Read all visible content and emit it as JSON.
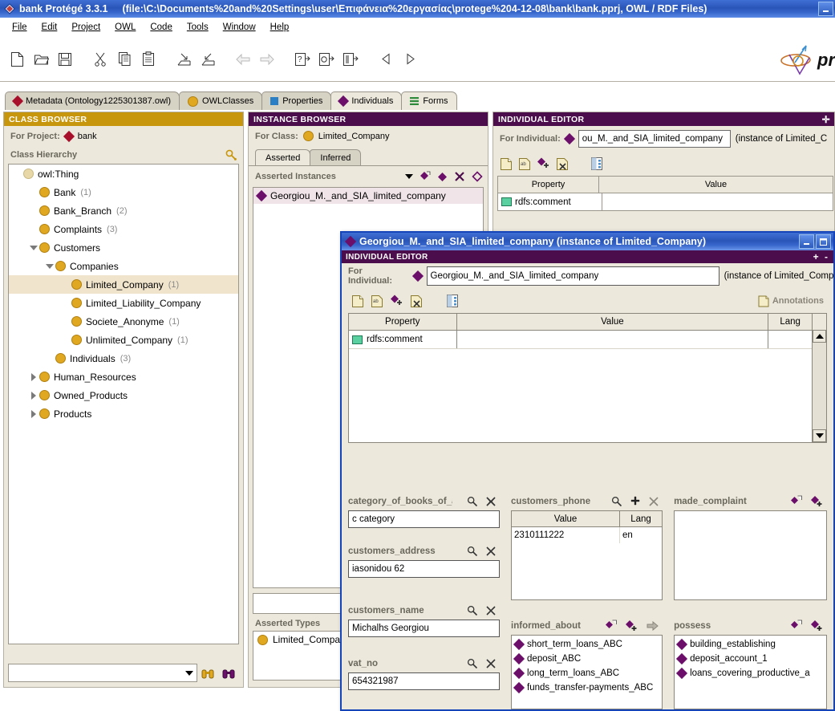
{
  "window": {
    "title": "bank  Protégé 3.3.1",
    "path": "(file:\\C:\\Documents%20and%20Settings\\user\\Επιφάνεια%20εργασίας\\protege%204-12-08\\bank\\bank.pprj,  OWL / RDF Files)",
    "icon": "protege-app-icon",
    "minimize_label": "_"
  },
  "menu": {
    "items": [
      {
        "label": "File",
        "name": "menu-file"
      },
      {
        "label": "Edit",
        "name": "menu-edit"
      },
      {
        "label": "Project",
        "name": "menu-project"
      },
      {
        "label": "OWL",
        "name": "menu-owl"
      },
      {
        "label": "Code",
        "name": "menu-code"
      },
      {
        "label": "Tools",
        "name": "menu-tools"
      },
      {
        "label": "Window",
        "name": "menu-window"
      },
      {
        "label": "Help",
        "name": "menu-help"
      }
    ]
  },
  "toolbar": {
    "icons": [
      "new-project-icon",
      "open-project-icon",
      "save-project-icon",
      "cut-icon",
      "copy-icon",
      "paste-icon",
      "import-icon",
      "export-icon",
      "undo-icon",
      "redo-icon",
      "query-icon",
      "create-icon",
      "instance-icon",
      "back-icon",
      "forward-icon"
    ],
    "logo_text": "pr"
  },
  "tabs": [
    {
      "label": "Metadata (Ontology1225301387.owl)",
      "icon": "red-diamond-icon",
      "active": false,
      "name": "tab-metadata"
    },
    {
      "label": "OWLClasses",
      "icon": "gold-circle-icon",
      "active": false,
      "name": "tab-owlclasses"
    },
    {
      "label": "Properties",
      "icon": "blue-square-icon",
      "active": false,
      "name": "tab-properties"
    },
    {
      "label": "Individuals",
      "icon": "purple-diamond-icon",
      "active": true,
      "name": "tab-individuals"
    },
    {
      "label": "Forms",
      "icon": "green-lines-icon",
      "active": false,
      "name": "tab-forms"
    }
  ],
  "class_browser": {
    "header": "CLASS BROWSER",
    "for_project_label": "For Project:",
    "project_name": "bank",
    "hierarchy_label": "Class Hierarchy",
    "search_icon": "class-search-icon",
    "tree": [
      {
        "label": "owl:Thing",
        "count": "",
        "indent": 0,
        "toggle": "none",
        "selected": false,
        "icon": "pale-circle-icon"
      },
      {
        "label": "Bank",
        "count": "(1)",
        "indent": 1,
        "toggle": "none",
        "selected": false,
        "icon": "gold-circle-icon"
      },
      {
        "label": "Bank_Branch",
        "count": "(2)",
        "indent": 1,
        "toggle": "none",
        "selected": false,
        "icon": "gold-circle-icon"
      },
      {
        "label": "Complaints",
        "count": "(3)",
        "indent": 1,
        "toggle": "none",
        "selected": false,
        "icon": "gold-circle-icon"
      },
      {
        "label": "Customers",
        "count": "",
        "indent": 1,
        "toggle": "down",
        "selected": false,
        "icon": "gold-circle-icon"
      },
      {
        "label": "Companies",
        "count": "",
        "indent": 2,
        "toggle": "down",
        "selected": false,
        "icon": "gold-circle-icon"
      },
      {
        "label": "Limited_Company",
        "count": "(1)",
        "indent": 3,
        "toggle": "none",
        "selected": true,
        "icon": "gold-circle-icon"
      },
      {
        "label": "Limited_Liability_Company",
        "count": "",
        "indent": 3,
        "toggle": "none",
        "selected": false,
        "icon": "gold-circle-icon"
      },
      {
        "label": "Societe_Anonyme",
        "count": "(1)",
        "indent": 3,
        "toggle": "none",
        "selected": false,
        "icon": "gold-circle-icon"
      },
      {
        "label": "Unlimited_Company",
        "count": "(1)",
        "indent": 3,
        "toggle": "none",
        "selected": false,
        "icon": "gold-circle-icon"
      },
      {
        "label": "Individuals",
        "count": "(3)",
        "indent": 2,
        "toggle": "none",
        "selected": false,
        "icon": "gold-circle-icon"
      },
      {
        "label": "Human_Resources",
        "count": "",
        "indent": 1,
        "toggle": "right",
        "selected": false,
        "icon": "gold-circle-icon"
      },
      {
        "label": "Owned_Products",
        "count": "",
        "indent": 1,
        "toggle": "right",
        "selected": false,
        "icon": "gold-circle-icon"
      },
      {
        "label": "Products",
        "count": "",
        "indent": 1,
        "toggle": "right",
        "selected": false,
        "icon": "gold-circle-icon"
      }
    ],
    "find_placeholder": "",
    "find_value": "",
    "find_icons": [
      "find-gold-binoculars-icon",
      "find-purple-binoculars-icon"
    ]
  },
  "instance_browser": {
    "header": "INSTANCE BROWSER",
    "for_class_label": "For Class:",
    "class_name": "Limited_Company",
    "subtabs": [
      {
        "label": "Asserted",
        "active": true,
        "name": "subtab-asserted"
      },
      {
        "label": "Inferred",
        "active": false,
        "name": "subtab-inferred"
      }
    ],
    "list_title": "Asserted Instances",
    "list_icons": [
      "sort-dropdown-icon",
      "create-instance-icon",
      "add-instance-icon",
      "delete-instance-icon",
      "clear-instance-icon"
    ],
    "instances": [
      {
        "label": "Georgiou_M._and_SIA_limited_company",
        "selected": true
      }
    ],
    "asserted_types_label": "Asserted Types",
    "asserted_types": [
      {
        "label": "Limited_Company"
      }
    ]
  },
  "individual_editor_bg": {
    "header": "INDIVIDUAL EDITOR",
    "for_individual_label": "For Individual:",
    "individual_name": "ou_M._and_SIA_limited_company",
    "instance_of": "(instance of Limited_C",
    "icons": [
      "new-note-icon",
      "edit-note-icon",
      "add-diamond-icon",
      "remove-note-icon",
      "split-view-icon"
    ],
    "columns": [
      "Property",
      "Value"
    ],
    "rows": [
      {
        "property": "rdfs:comment",
        "value": "",
        "icon": "datatype-icon"
      }
    ]
  },
  "dialog": {
    "title": "Georgiou_M._and_SIA_limited_company   (instance of Limited_Company)",
    "title_icon": "purple-diamond-icon",
    "buttons": [
      "minimize-button",
      "maximize-button"
    ],
    "header": "INDIVIDUAL EDITOR",
    "header_icons": "+ -",
    "for_individual_label": "For Individual:",
    "individual_name": "Georgiou_M._and_SIA_limited_company",
    "instance_of": "(instance of Limited_Comp",
    "icons": [
      "new-note-icon",
      "edit-note-icon",
      "add-diamond-icon",
      "remove-note-icon",
      "split-view-icon"
    ],
    "annotations_label": "Annotations",
    "table": {
      "columns": [
        "Property",
        "Value",
        "Lang"
      ],
      "rows": [
        {
          "property": "rdfs:comment",
          "value": "",
          "lang": "",
          "icon": "datatype-icon"
        }
      ]
    },
    "slots": [
      {
        "name": "category_of_books_of_a",
        "label": "category_of_books_of_a",
        "type": "text",
        "value": "c category",
        "icons": [
          "magnifier-icon",
          "clear-x-icon"
        ]
      },
      {
        "name": "customers_address",
        "label": "customers_address",
        "type": "text",
        "value": "iasonidou 62",
        "icons": [
          "magnifier-icon",
          "clear-x-icon"
        ]
      },
      {
        "name": "customers_name",
        "label": "customers_name",
        "type": "text",
        "value": "Michalhs Georgiou",
        "icons": [
          "magnifier-icon",
          "clear-x-icon"
        ]
      },
      {
        "name": "vat_no",
        "label": "vat_no",
        "type": "text",
        "value": "654321987",
        "icons": [
          "magnifier-icon",
          "clear-x-icon"
        ]
      },
      {
        "name": "customers_phone",
        "label": "customers_phone",
        "type": "table",
        "columns": [
          "Value",
          "Lang"
        ],
        "rows": [
          {
            "value": "2310111222",
            "lang": "en"
          }
        ],
        "icons": [
          "magnifier-icon",
          "add-plus-icon",
          "clear-x-icon"
        ]
      },
      {
        "name": "informed_about",
        "label": "informed_about",
        "type": "list",
        "items": [
          "short_term_loans_ABC",
          "deposit_ABC",
          "long_term_loans_ABC",
          "funds_transfer-payments_ABC"
        ],
        "icons": [
          "create-diamond-icon",
          "add-diamond-icon",
          "remove-icon"
        ]
      },
      {
        "name": "made_complaint",
        "label": "made_complaint",
        "type": "list",
        "items": [],
        "icons": [
          "create-diamond-icon",
          "add-diamond-icon"
        ]
      },
      {
        "name": "possess",
        "label": "possess",
        "type": "list",
        "items": [
          "building_establishing",
          "deposit_account_1",
          "loans_covering_productive_a"
        ],
        "icons": [
          "create-diamond-icon",
          "add-diamond-icon"
        ]
      }
    ]
  }
}
